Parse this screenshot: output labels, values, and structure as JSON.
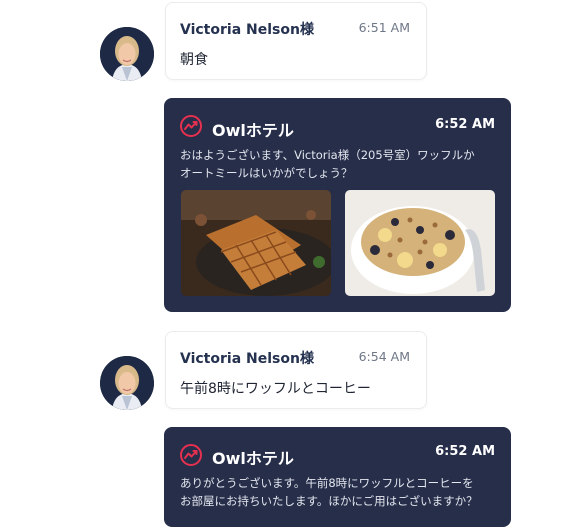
{
  "messages": [
    {
      "sender": "Victoria Nelson様",
      "time": "6:51 AM",
      "text": "朝食"
    },
    {
      "sender": "Owlホテル",
      "time": "6:52 AM",
      "text_line1": "おはようございます、Victoria様（205号室）ワッフルか",
      "text_line2": "オートミールはいかがでしょう？"
    },
    {
      "sender": "Victoria Nelson様",
      "time": "6:54 AM",
      "text": "午前8時にワッフルとコーヒー"
    },
    {
      "sender": "Owlホテル",
      "time": "6:52 AM",
      "text_line1": "ありがとうございます。午前8時にワッフルとコーヒーを",
      "text_line2": "お部屋にお持ちいたします。ほかにご用はございますか？"
    }
  ],
  "colors": {
    "hotel_card": "#262e4a",
    "brand_icon": "#e5304f",
    "guest_name": "#24314f"
  },
  "icons": {
    "hotel": "owl-logo-icon"
  }
}
